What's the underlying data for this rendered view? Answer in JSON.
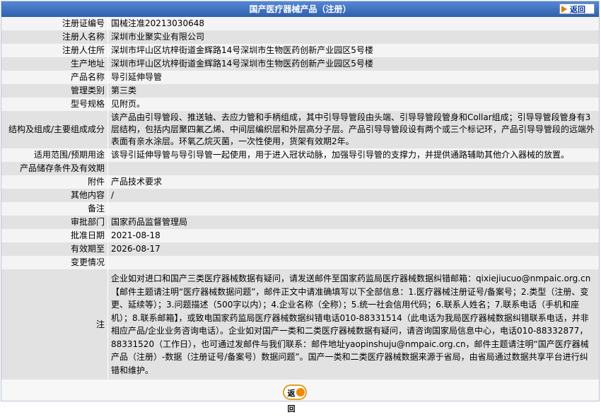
{
  "header": {
    "title": "国产医疗器械产品（注册）",
    "back_label": "返回"
  },
  "rows": [
    {
      "label": "注册证编号",
      "value": "国械注准20213030648"
    },
    {
      "label": "注册人名称",
      "value": "深圳市业聚实业有限公司"
    },
    {
      "label": "注册人住所",
      "value": "深圳市坪山区坑梓街道金辉路14号深圳市生物医药创新产业园区5号楼"
    },
    {
      "label": "生产地址",
      "value": "深圳市坪山区坑梓街道金辉路14号深圳市生物医药创新产业园区5号楼"
    },
    {
      "label": "产品名称",
      "value": "导引延伸导管"
    },
    {
      "label": "管理类别",
      "value": "第三类"
    },
    {
      "label": "型号规格",
      "value": "见附页。"
    },
    {
      "label": "结构及组成/主要组成成分",
      "value": "该产品由引导管段、推送轴、去应力管和手柄组成，其中引导导管段由头端、引导导管段管身和Collar组成；引导导管段管身有3层结构，包括内层聚四氟乙烯、中间层编织层和外层高分子层。产品引导导管段设有两个或三个标记环，产品引导导管段的远端外表面有亲水涂层。环氧乙烷灭菌，一次性使用，货架有效期2年。"
    },
    {
      "label": "适用范围/预期用途",
      "value": "该导引延伸导管与导引导管一起使用，用于进入冠状动脉，加强导引导管的支撑力，并提供通路辅助其他介入器械的放置。"
    },
    {
      "label": "产品储存条件及有效期",
      "value": ""
    },
    {
      "label": "附件",
      "value": "产品技术要求"
    },
    {
      "label": "其他内容",
      "value": "/"
    },
    {
      "label": "备注",
      "value": ""
    },
    {
      "label": "审批部门",
      "value": "国家药品监督管理局"
    },
    {
      "label": "批准日期",
      "value": "2021-08-18"
    },
    {
      "label": "有效期至",
      "value": "2026-08-17"
    },
    {
      "label": "变更情况",
      "value": ""
    }
  ],
  "note": {
    "label": "注",
    "text": "企业如对进口和国产三类医疗器械数据有疑问，请发送邮件至国家药监局医疗器械数据纠错邮箱：qixiejiucuo@nmpaic.org.cn【邮件主题请注明“医疗器械数据问题”，邮件正文中请准确填写以下全部信息：1.医疗器械注册证号/备案号；2.类型（注册、变更、延续等）；3.问题描述（500字以内）；4.企业名称（全称）；5.统一社会信用代码；6.联系人姓名；7.联系电话（手机和座机）；8.联系邮箱】，或致电国家药监局医疗器械数据纠错电话010-88331514（此电话为我局医疗器械数据纠错联系电话，并非相应产品/企业业务咨询电话）。企业如对国产一类和二类医疗器械数据有疑问，请咨询国家局信息中心，电话010-88332877，88331520（工作日），也可通过发邮件与我们联系：邮件地址yaopinshuju@nmpaic.org.cn，邮件主题请注明“国产医疗器械产品（注册）-数据（注册证号/备案号）数据问题”。国产一类和二类医疗器械数据来源于省局，由省局通过数据共享平台进行纠错和维护。"
  },
  "footer": {
    "back_label": "返回"
  }
}
